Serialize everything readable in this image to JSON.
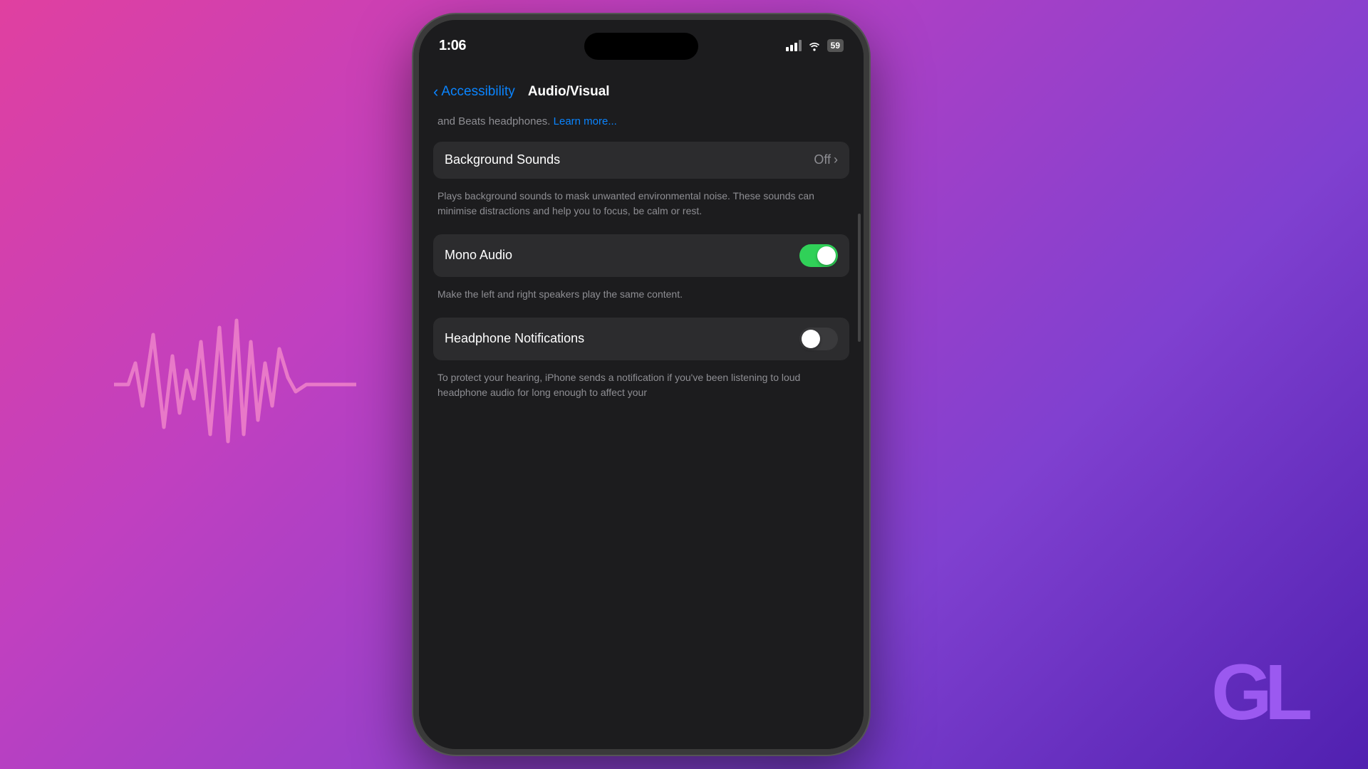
{
  "background": {
    "gradient_start": "#e040a0",
    "gradient_end": "#5020b0"
  },
  "phone": {
    "status_bar": {
      "time": "1:06",
      "signal_label": "signal bars",
      "wifi_label": "wifi",
      "battery_level": "59"
    },
    "nav": {
      "back_label": "Accessibility",
      "title": "Audio/Visual"
    },
    "top_text": "and Beats headphones.",
    "learn_more_label": "Learn more...",
    "sections": [
      {
        "id": "background-sounds",
        "label": "Background Sounds",
        "value": "Off",
        "has_chevron": true,
        "description": "Plays background sounds to mask unwanted environmental noise. These sounds can minimise distractions and help you to focus, be calm or rest."
      },
      {
        "id": "mono-audio",
        "label": "Mono Audio",
        "toggle": true,
        "toggle_state": "on",
        "description": "Make the left and right speakers play the same content."
      },
      {
        "id": "headphone-notifications",
        "label": "Headphone Notifications",
        "toggle": true,
        "toggle_state": "off",
        "description": "To protect your hearing, iPhone sends a notification if you've been listening to loud headphone audio for long enough to affect your"
      }
    ]
  },
  "gt_logo": {
    "text": "GL",
    "color": "#a855f7"
  }
}
